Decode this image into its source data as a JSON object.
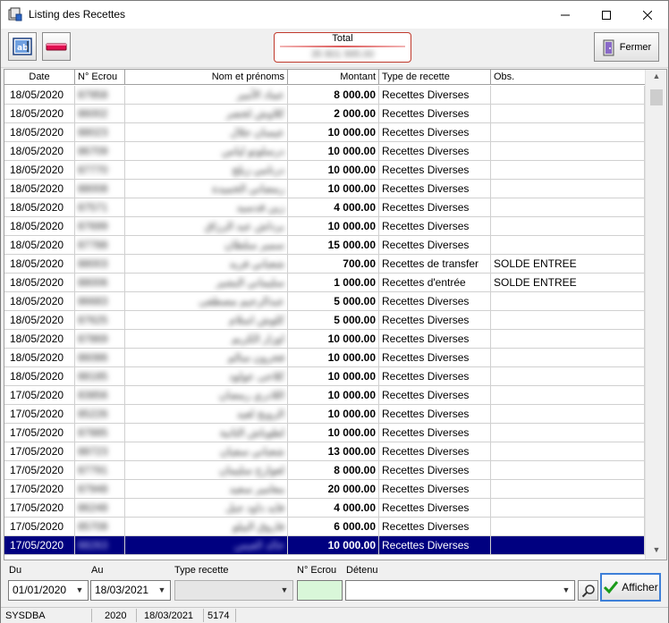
{
  "window": {
    "title": "Listing des Recettes"
  },
  "toolbar": {
    "total_label": "Total",
    "total_value": "35 801 995.00",
    "fermer_label": "Fermer"
  },
  "grid": {
    "columns": [
      "Date",
      "N° Ecrou",
      "Nom et prénoms",
      "Montant",
      "Type de recette",
      "Obs."
    ],
    "rows": [
      {
        "date": "18/05/2020",
        "ecrou": "87958",
        "nom": "عماد الأمير",
        "montant": "8 000.00",
        "type": "Recettes Diverses",
        "obs": ""
      },
      {
        "date": "18/05/2020",
        "ecrou": "86002",
        "nom": "كلاوش لخضر",
        "montant": "2 000.00",
        "type": "Recettes Diverses",
        "obs": ""
      },
      {
        "date": "18/05/2020",
        "ecrou": "88023",
        "nom": "عيسان جلال",
        "montant": "10 000.00",
        "type": "Recettes Diverses",
        "obs": ""
      },
      {
        "date": "18/05/2020",
        "ecrou": "86709",
        "nom": "درسلوتو لياس",
        "montant": "10 000.00",
        "type": "Recettes Diverses",
        "obs": ""
      },
      {
        "date": "18/05/2020",
        "ecrou": "87770",
        "nom": "درنامي زبلج",
        "montant": "10 000.00",
        "type": "Recettes Diverses",
        "obs": ""
      },
      {
        "date": "18/05/2020",
        "ecrou": "88008",
        "nom": "رمضاني الخميدة",
        "montant": "10 000.00",
        "type": "Recettes Diverses",
        "obs": ""
      },
      {
        "date": "18/05/2020",
        "ecrou": "87571",
        "nom": "زين قدسيد",
        "montant": "4 000.00",
        "type": "Recettes Diverses",
        "obs": ""
      },
      {
        "date": "18/05/2020",
        "ecrou": "87699",
        "nom": "برداش عبد الرزاق",
        "montant": "10 000.00",
        "type": "Recettes Diverses",
        "obs": ""
      },
      {
        "date": "18/05/2020",
        "ecrou": "87788",
        "nom": "سمير سلطان",
        "montant": "15 000.00",
        "type": "Recettes Diverses",
        "obs": ""
      },
      {
        "date": "18/05/2020",
        "ecrou": "88003",
        "nom": "شعباني فريد",
        "montant": "700.00",
        "type": "Recettes de transfer",
        "obs": "SOLDE ENTREE"
      },
      {
        "date": "18/05/2020",
        "ecrou": "88006",
        "nom": "سليماني البشير",
        "montant": "1 000.00",
        "type": "Recettes d'entrée",
        "obs": "SOLDE ENTREE"
      },
      {
        "date": "18/05/2020",
        "ecrou": "86683",
        "nom": "عبدالرحيم مصطفى",
        "montant": "5 000.00",
        "type": "Recettes Diverses",
        "obs": ""
      },
      {
        "date": "18/05/2020",
        "ecrou": "87625",
        "nom": "كلوش اسلام",
        "montant": "5 000.00",
        "type": "Recettes Diverses",
        "obs": ""
      },
      {
        "date": "18/05/2020",
        "ecrou": "87869",
        "nom": "اوزار الكريم",
        "montant": "10 000.00",
        "type": "Recettes Diverses",
        "obs": ""
      },
      {
        "date": "18/05/2020",
        "ecrou": "86086",
        "nom": "فخرون سالم",
        "montant": "10 000.00",
        "type": "Recettes Diverses",
        "obs": ""
      },
      {
        "date": "18/05/2020",
        "ecrou": "88185",
        "nom": "كلاحى عولود",
        "montant": "10 000.00",
        "type": "Recettes Diverses",
        "obs": ""
      },
      {
        "date": "17/05/2020",
        "ecrou": "83856",
        "nom": "اللادري رمضان",
        "montant": "10 000.00",
        "type": "Recettes Diverses",
        "obs": ""
      },
      {
        "date": "17/05/2020",
        "ecrou": "85226",
        "nom": "الرويح لعيد",
        "montant": "10 000.00",
        "type": "Recettes Diverses",
        "obs": ""
      },
      {
        "date": "17/05/2020",
        "ecrou": "87885",
        "nom": "لطوباش الثانية",
        "montant": "10 000.00",
        "type": "Recettes Diverses",
        "obs": ""
      },
      {
        "date": "17/05/2020",
        "ecrou": "88723",
        "nom": "شعباني سفيان",
        "montant": "13 000.00",
        "type": "Recettes Diverses",
        "obs": ""
      },
      {
        "date": "17/05/2020",
        "ecrou": "87791",
        "nom": "لعوارج سليمان",
        "montant": "8 000.00",
        "type": "Recettes Diverses",
        "obs": ""
      },
      {
        "date": "17/05/2020",
        "ecrou": "87948",
        "nom": "معامير سعيد",
        "montant": "20 000.00",
        "type": "Recettes Diverses",
        "obs": ""
      },
      {
        "date": "17/05/2020",
        "ecrou": "86248",
        "nom": "فايد داود جبل",
        "montant": "4 000.00",
        "type": "Recettes Diverses",
        "obs": ""
      },
      {
        "date": "17/05/2020",
        "ecrou": "85708",
        "nom": "فاروق البيلو",
        "montant": "6 000.00",
        "type": "Recettes Diverses",
        "obs": ""
      },
      {
        "date": "17/05/2020",
        "ecrou": "88263",
        "nom": "خالد العيس",
        "montant": "10 000.00",
        "type": "Recettes Diverses",
        "obs": ""
      }
    ],
    "selected_index": 24
  },
  "filters": {
    "du_label": "Du",
    "du_value": "01/01/2020",
    "au_label": "Au",
    "au_value": "18/03/2021",
    "type_label": "Type recette",
    "type_value": "",
    "ecrou_label": "N° Ecrou",
    "ecrou_value": "",
    "detenu_label": "Détenu",
    "detenu_value": "",
    "afficher_label": "Afficher"
  },
  "statusbar": {
    "user": "SYSDBA",
    "year": "2020",
    "date": "18/03/2021",
    "count": "5174"
  }
}
